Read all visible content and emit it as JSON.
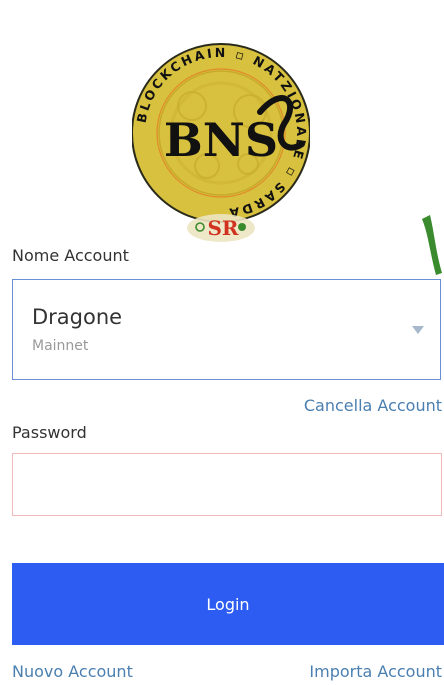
{
  "logo": {
    "ring_text_top": "BLOCKCHAIN ▫ NATZIONALE ▫ SARDA",
    "main_text": "BNS",
    "sub_text": "SR",
    "colors": {
      "gold": "#d8c13e",
      "ring": "#e0b72a",
      "ink": "#111111",
      "green": "#3a8a2e"
    }
  },
  "form": {
    "account_label": "Nome Account",
    "account_name": "Dragone",
    "account_network": "Mainnet",
    "delete_account_link": "Cancella Account",
    "password_label": "Password",
    "password_value": "",
    "login_button": "Login",
    "new_account_link": "Nuovo Account",
    "import_account_link": "Importa Account"
  },
  "colors": {
    "primary": "#2c5cf1",
    "link": "#4a7fb0",
    "select_border": "#6b8fd6",
    "error_border": "#f2b9b9"
  }
}
